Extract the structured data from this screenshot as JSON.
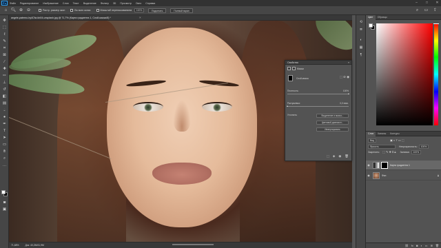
{
  "menubar": {
    "logo": "Ps",
    "items": [
      "Файл",
      "Редактирование",
      "Изображение",
      "Слои",
      "Текст",
      "Выделение",
      "Фильтр",
      "3D",
      "Просмотр",
      "Окно",
      "Справка"
    ]
  },
  "options": {
    "antialias_label": "Растр. размер окон",
    "all_windows_label": "Во всех окнах",
    "scrubby_label": "Масштаб перетаскиванием",
    "zoom_value": "100%",
    "fit_label": "Подогнать",
    "fill_label": "Полный экран"
  },
  "document": {
    "tab_title": "angele-paterno-by4Cfw-kb04-unsplash.jpg @ 71,7% (Карта градиента 1, Слой-маска/8) *",
    "close": "×"
  },
  "properties": {
    "title": "Свойства",
    "close": "»",
    "sub_label": "Маски",
    "mask_name": "Слой-маска",
    "density_label": "Плотность:",
    "density_value": "100%",
    "density": 1.0,
    "feather_label": "Растушевка:",
    "feather_value": "0,0 пикс.",
    "feather": 0.0,
    "refine_label": "Уточнить:",
    "btn_select_mask": "Выделение и маска...",
    "btn_color_range": "Цветовой диапазон...",
    "btn_invert": "Инвертировать"
  },
  "color_panel": {
    "tabs": [
      "Цвет",
      "Образцы"
    ],
    "active_tab": 0,
    "foreground": "#ffffff",
    "background": "#000000"
  },
  "layers_panel": {
    "tabs": [
      "Слои",
      "Каналы",
      "Контуры"
    ],
    "kind_label": "Вид",
    "blend_mode": "Яркость",
    "opacity_label": "Непрозрачность:",
    "opacity_value": "100%",
    "lock_label": "Закрепить:",
    "fill_label": "Заливка:",
    "fill_value": "100%",
    "layers": [
      {
        "name": "Карта градиента 1",
        "selected": true
      },
      {
        "name": "Фон",
        "selected": false
      }
    ]
  },
  "statusbar": {
    "zoom": "71,68%",
    "doc": "Док: 40,2M/41,9M"
  }
}
